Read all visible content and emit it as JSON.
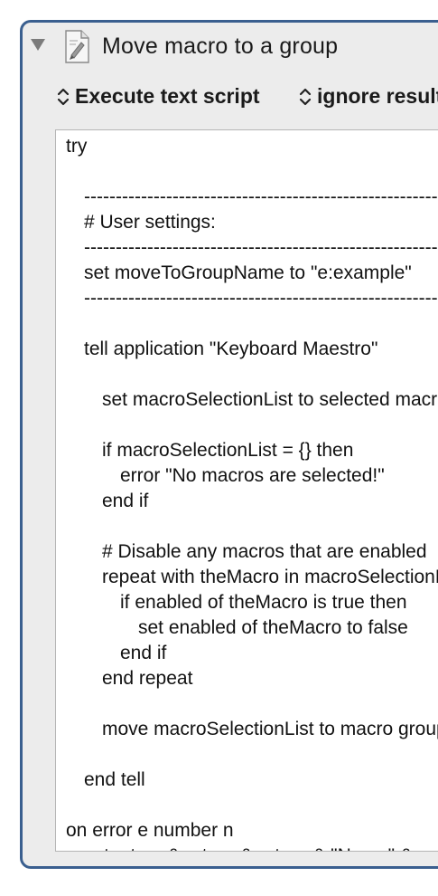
{
  "action": {
    "title": "Move macro to a group",
    "execute_mode": "Execute text script",
    "result_mode": "ignore results"
  },
  "script": {
    "lines": [
      "try",
      "----------------------------------------------------------------------",
      "# User settings:",
      "----------------------------------------------------------------------",
      "set moveToGroupName to \"e:example\"",
      "----------------------------------------------------------------------",
      "tell application \"Keyboard Maestro\"",
      "set macroSelectionList to selected macros",
      "if macroSelectionList = {} then",
      "error \"No macros are selected!\"",
      "end if",
      "# Disable any macros that are enabled",
      "repeat with theMacro in macroSelectionList",
      "if enabled of theMacro is true then",
      "set enabled of theMacro to false",
      "end if",
      "end repeat",
      "move macroSelectionList to macro group",
      "end tell",
      "on error e number n",
      "set e to e & return & return & \"Num: \" & n"
    ]
  }
}
